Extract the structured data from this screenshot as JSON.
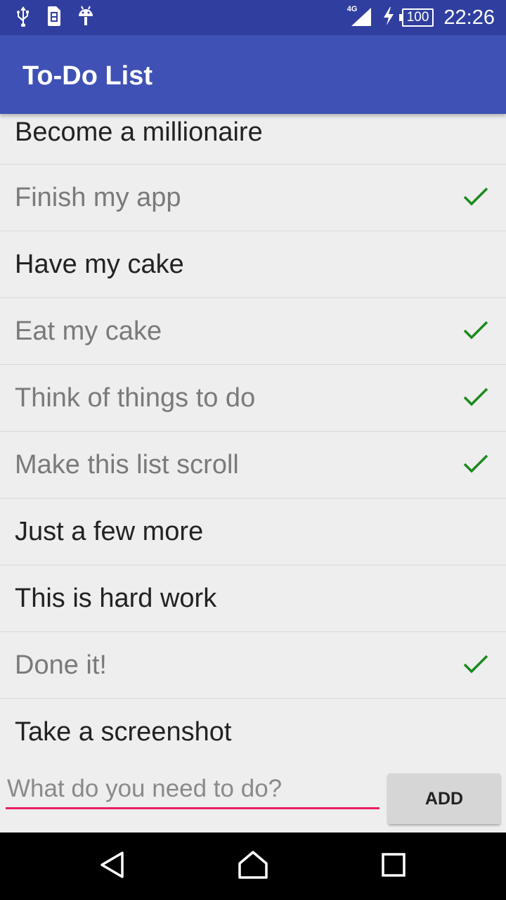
{
  "status_bar": {
    "network_label": "4G",
    "battery_level": "100",
    "time": "22:26",
    "icons": [
      "usb-icon",
      "sim-notification-icon",
      "android-debug-icon",
      "signal-icon",
      "charging-icon",
      "battery-icon"
    ]
  },
  "app_bar": {
    "title": "To-Do List",
    "color": "#3f51b5"
  },
  "todo_items": [
    {
      "label": "Become a millionaire",
      "done": false
    },
    {
      "label": "Finish my app",
      "done": true
    },
    {
      "label": "Have my cake",
      "done": false
    },
    {
      "label": "Eat my cake",
      "done": true
    },
    {
      "label": "Think of things to do",
      "done": true
    },
    {
      "label": "Make this list scroll",
      "done": true
    },
    {
      "label": "Just a few more",
      "done": false
    },
    {
      "label": "This is hard work",
      "done": false
    },
    {
      "label": "Done it!",
      "done": true
    },
    {
      "label": "Take a screenshot",
      "done": false
    }
  ],
  "new_task": {
    "placeholder": "What do you need to do?",
    "value": "",
    "add_label": "ADD",
    "accent": "#e91e63"
  },
  "colors": {
    "check": "#1b8a1b",
    "done_text": "#7a7a7a",
    "open_text": "#222222"
  },
  "nav_bar": {
    "icons": [
      "back-icon",
      "home-icon",
      "recents-icon"
    ]
  }
}
